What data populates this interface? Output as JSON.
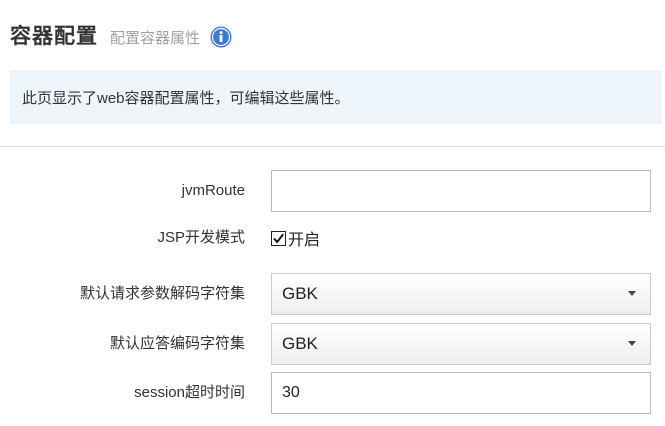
{
  "header": {
    "title": "容器配置",
    "subtitle": "配置容器属性",
    "info_icon": "info-icon",
    "info_icon_color": "#3a7bd5"
  },
  "banner": {
    "text": "此页显示了web容器配置属性，可编辑这些属性。",
    "background": "#edf4fa"
  },
  "form": {
    "jvm_route": {
      "label": "jvmRoute",
      "value": ""
    },
    "jsp_dev_mode": {
      "label": "JSP开发模式",
      "checked": true,
      "option_label": "开启"
    },
    "request_charset": {
      "label": "默认请求参数解码字符集",
      "value": "GBK"
    },
    "response_charset": {
      "label": "默认应答编码字符集",
      "value": "GBK"
    },
    "session_timeout": {
      "label": "session超时时间",
      "value": "30"
    }
  }
}
